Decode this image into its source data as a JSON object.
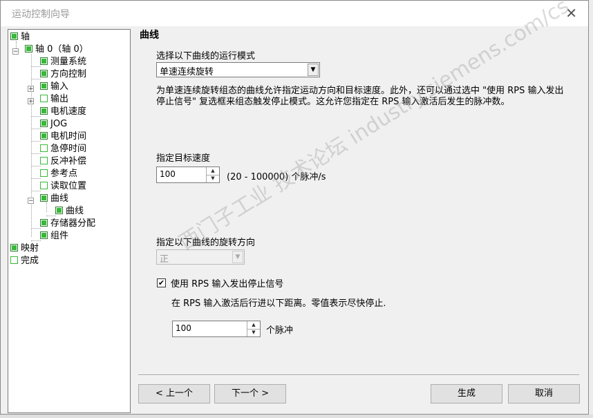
{
  "window": {
    "title": "运动控制向导",
    "close_icon": "close-icon"
  },
  "tree": {
    "items": [
      {
        "label": "轴",
        "state": "checked"
      },
      {
        "label": "轴 0（轴 0）",
        "state": "checked"
      },
      {
        "label": "测量系统",
        "state": "checked"
      },
      {
        "label": "方向控制",
        "state": "checked"
      },
      {
        "label": "输入",
        "state": "checked"
      },
      {
        "label": "输出",
        "state": "empty"
      },
      {
        "label": "电机速度",
        "state": "checked"
      },
      {
        "label": "JOG",
        "state": "checked"
      },
      {
        "label": "电机时间",
        "state": "checked"
      },
      {
        "label": "急停时间",
        "state": "empty"
      },
      {
        "label": "反冲补偿",
        "state": "empty"
      },
      {
        "label": "参考点",
        "state": "empty"
      },
      {
        "label": "读取位置",
        "state": "empty"
      },
      {
        "label": "曲线",
        "state": "checked"
      },
      {
        "label": "曲线",
        "state": "checked"
      },
      {
        "label": "存储器分配",
        "state": "checked"
      },
      {
        "label": "组件",
        "state": "checked"
      },
      {
        "label": "映射",
        "state": "checked"
      },
      {
        "label": "完成",
        "state": "empty"
      }
    ]
  },
  "main": {
    "heading": "曲线",
    "mode_label": "选择以下曲线的运行模式",
    "mode_value": "单速连续旋转",
    "description": "为单速连续旋转组态的曲线允许指定运动方向和目标速度。此外，还可以通过选中 \"使用 RPS 输入发出停止信号\" 复选框来组态触发停止模式。这允许您指定在 RPS 输入激活后发生的脉冲数。",
    "speed_label": "指定目标速度",
    "speed_value": "100",
    "speed_range": "(20 - 100000) 个脉冲/s",
    "direction_label": "指定以下曲线的旋转方向",
    "direction_value": "正",
    "rps_checkbox_label": "使用 RPS 输入发出停止信号",
    "rps_checked": true,
    "rps_desc": "在 RPS 输入激活后行进以下距离。零值表示尽快停止.",
    "distance_value": "100",
    "distance_unit": "个脉冲"
  },
  "buttons": {
    "prev": "< 上一个",
    "next": "下一个 >",
    "generate": "生成",
    "cancel": "取消"
  },
  "watermark": "西门子工业  技术论坛  industry.siemens.com/cs"
}
